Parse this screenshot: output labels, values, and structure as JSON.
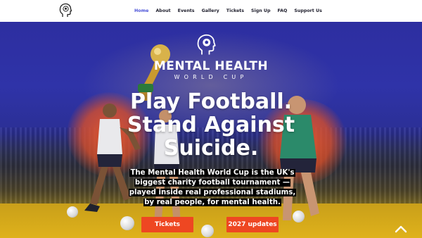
{
  "nav": {
    "items": [
      {
        "label": "Home",
        "active": true
      },
      {
        "label": "About"
      },
      {
        "label": "Events"
      },
      {
        "label": "Gallery"
      },
      {
        "label": "Tickets"
      },
      {
        "label": "Sign Up"
      },
      {
        "label": "FAQ"
      },
      {
        "label": "Support Us"
      }
    ],
    "logo_icon": "head-football-icon"
  },
  "hero": {
    "brand_title": "MENTAL HEALTH",
    "brand_subtitle": "WORLD CUP",
    "brand_icon": "head-football-icon",
    "headline": [
      "Play Football.",
      "Stand Against",
      "Suicide."
    ],
    "tagline": "The Mental Health World Cup is the UK's biggest charity football tournament — played inside real professional stadiums, by real people, for mental health.",
    "buttons": {
      "tickets": "Tickets",
      "updates": "2027 updates"
    },
    "scroll_icon": "chevron-up-icon"
  },
  "colors": {
    "accent": "#ee4722",
    "nav_active": "#4a52d8",
    "hero_blue": "#2f33a8",
    "pitch_gold": "#d9ad1a"
  }
}
